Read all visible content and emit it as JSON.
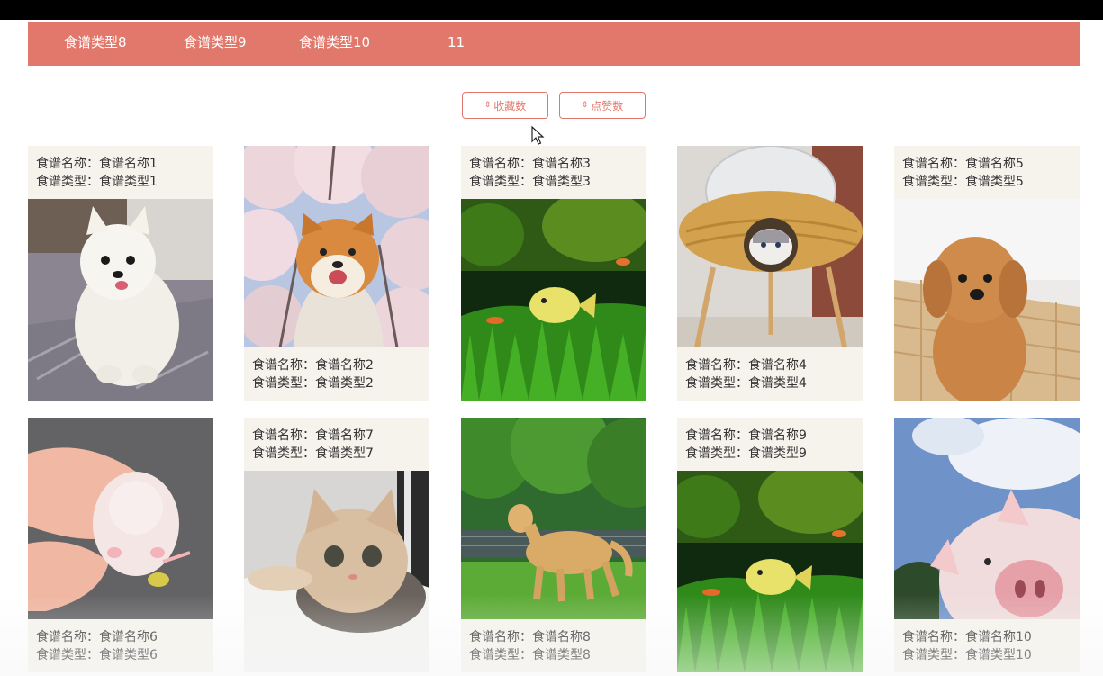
{
  "nav": {
    "items": [
      "食谱类型8",
      "食谱类型9",
      "食谱类型10",
      "11"
    ]
  },
  "sort": {
    "favorites_label": "收藏数",
    "likes_label": "点赞数"
  },
  "field_labels": {
    "name": "食谱名称：",
    "type": "食谱类型："
  },
  "cards": [
    {
      "name": "食谱名称1",
      "type": "食谱类型1",
      "image": "white-pomeranian-photo"
    },
    {
      "name": "食谱名称2",
      "type": "食谱类型2",
      "image": "shiba-cherry-blossom-photo"
    },
    {
      "name": "食谱名称3",
      "type": "食谱类型3",
      "image": "fish-grass-photo"
    },
    {
      "name": "食谱名称4",
      "type": "食谱类型4",
      "image": "cat-wicker-bed-photo"
    },
    {
      "name": "食谱名称5",
      "type": "食谱类型5",
      "image": "poodle-photo"
    },
    {
      "name": "食谱名称6",
      "type": "食谱类型6",
      "image": "hamster-in-hand-photo"
    },
    {
      "name": "食谱名称7",
      "type": "食谱类型7",
      "image": "kitten-in-box-photo"
    },
    {
      "name": "食谱名称8",
      "type": "食谱类型8",
      "image": "golden-retriever-photo"
    },
    {
      "name": "食谱名称9",
      "type": "食谱类型9",
      "image": "fish-grass-photo"
    },
    {
      "name": "食谱名称10",
      "type": "食谱类型10",
      "image": "pig-sky-photo"
    }
  ],
  "colors": {
    "accent": "#e2786b",
    "info_bg": "#f5f3ec"
  }
}
